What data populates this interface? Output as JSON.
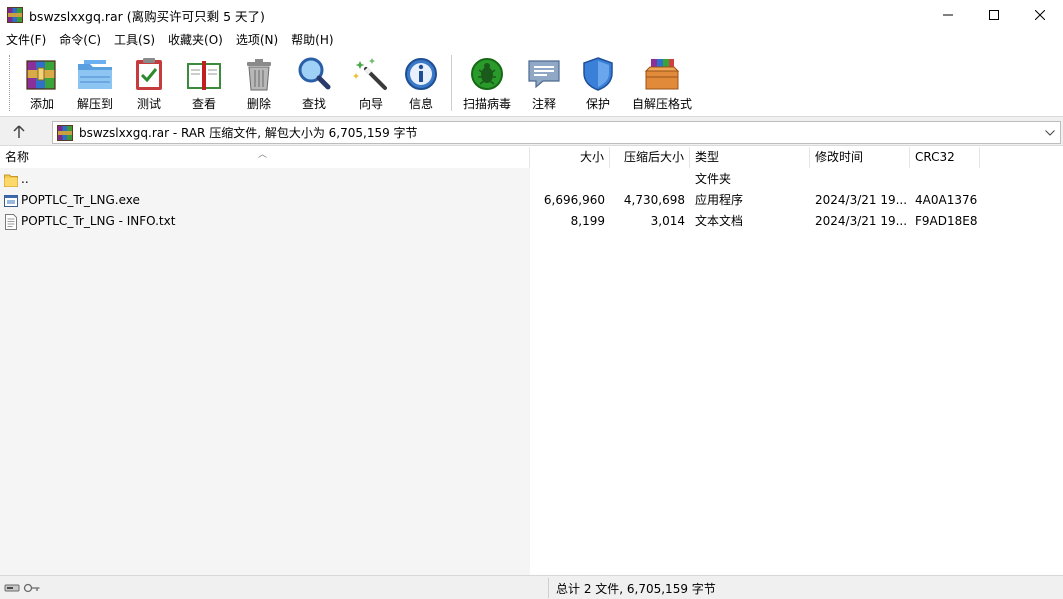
{
  "window": {
    "title": "bswzslxxgq.rar (离购买许可只剩 5 天了)"
  },
  "menu": [
    "文件(F)",
    "命令(C)",
    "工具(S)",
    "收藏夹(O)",
    "选项(N)",
    "帮助(H)"
  ],
  "toolbar": {
    "add": "添加",
    "extract_to": "解压到",
    "test": "测试",
    "view": "查看",
    "delete": "删除",
    "find": "查找",
    "wizard": "向导",
    "info": "信息",
    "virus_scan": "扫描病毒",
    "comment": "注释",
    "protect": "保护",
    "sfx": "自解压格式"
  },
  "address": {
    "text": "bswzslxxgq.rar - RAR 压缩文件, 解包大小为 6,705,159 字节"
  },
  "columns": {
    "name": "名称",
    "size": "大小",
    "packed": "压缩后大小",
    "type": "类型",
    "modified": "修改时间",
    "crc": "CRC32"
  },
  "files": [
    {
      "name": "..",
      "size": "",
      "packed": "",
      "type": "文件夹",
      "modified": "",
      "crc": "",
      "icon": "folder-icon"
    },
    {
      "name": "POPTLC_Tr_LNG.exe",
      "size": "6,696,960",
      "packed": "4,730,698",
      "type": "应用程序",
      "modified": "2024/3/21 19...",
      "crc": "4A0A1376",
      "icon": "exe-icon"
    },
    {
      "name": "POPTLC_Tr_LNG - INFO.txt",
      "size": "8,199",
      "packed": "3,014",
      "type": "文本文档",
      "modified": "2024/3/21 19...",
      "crc": "F9AD18E8",
      "icon": "text-file-icon"
    }
  ],
  "status": {
    "summary": "总计 2 文件, 6,705,159 字节"
  }
}
